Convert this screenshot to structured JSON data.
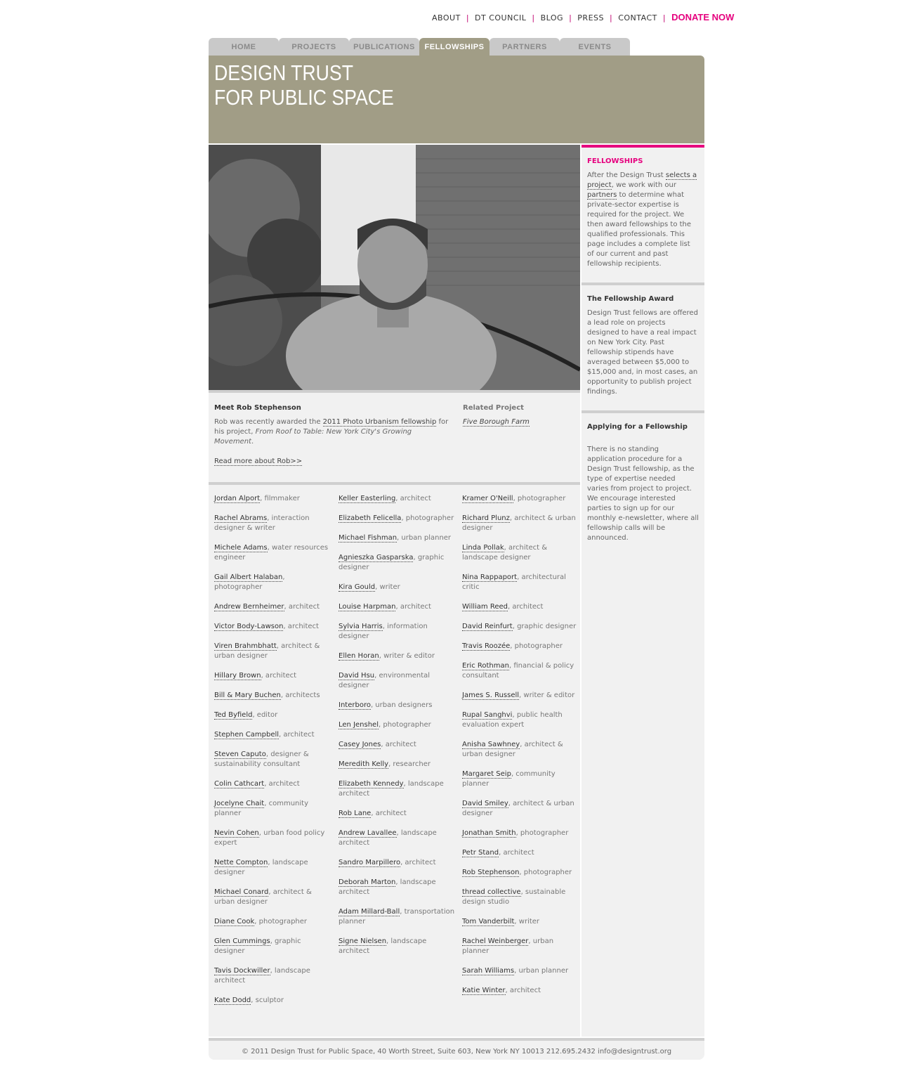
{
  "topnav": {
    "items": [
      "ABOUT",
      "DT COUNCIL",
      "BLOG",
      "PRESS",
      "CONTACT"
    ],
    "donate": "DONATE NOW"
  },
  "tabs": [
    "HOME",
    "PROJECTS",
    "PUBLICATIONS",
    "FELLOWSHIPS",
    "PARTNERS",
    "EVENTS"
  ],
  "active_tab": "FELLOWSHIPS",
  "logo": {
    "line1": "DESIGN TRUST",
    "line2": "FOR PUBLIC SPACE"
  },
  "colors": {
    "accent": "#e6007e",
    "banner": "#a19d86",
    "panel": "#f1f1f1"
  },
  "meet": {
    "title": "Meet Rob Stephenson",
    "text_before": "Rob was recently awarded the ",
    "link": "2011 Photo Urbanism fellowship",
    "text_mid": " for his project, ",
    "project_title": "From Roof to Table: New York City's Growing Movement",
    "text_end": ".",
    "read_more": "Read more about Rob>>"
  },
  "related": {
    "title": "Related Project",
    "link": "Five Borough Farm"
  },
  "fellows": {
    "col1": [
      {
        "name": "Jordan Alport",
        "role": ", filmmaker"
      },
      {
        "name": "Rachel Abrams",
        "role": ", interaction designer & writer"
      },
      {
        "name": "Michele Adams",
        "role": ", water resources engineer"
      },
      {
        "name": "Gail Albert Halaban",
        "role": ", photographer"
      },
      {
        "name": "Andrew Bernheimer",
        "role": ", architect"
      },
      {
        "name": "Victor Body-Lawson",
        "role": ", architect"
      },
      {
        "name": "Viren Brahmbhatt",
        "role": ", architect & urban designer"
      },
      {
        "name": "Hillary Brown",
        "role": ", architect"
      },
      {
        "name": "Bill & Mary Buchen",
        "role": ", architects"
      },
      {
        "name": "Ted Byfield",
        "role": ", editor"
      },
      {
        "name": "Stephen Campbell",
        "role": ", architect"
      },
      {
        "name": "Steven Caputo",
        "role": ", designer & sustainability consultant"
      },
      {
        "name": "Colin Cathcart",
        "role": ", architect"
      },
      {
        "name": "Jocelyne Chait",
        "role": ", community planner"
      },
      {
        "name": "Nevin Cohen",
        "role": ", urban food policy expert"
      },
      {
        "name": "Nette Compton",
        "role": ", landscape designer"
      },
      {
        "name": "Michael Conard",
        "role": ", architect & urban designer"
      },
      {
        "name": "Diane Cook",
        "role": ", photographer"
      },
      {
        "name": "Glen Cummings",
        "role": ", graphic designer"
      },
      {
        "name": "Tavis Dockwiller",
        "role": ", landscape architect"
      },
      {
        "name": "Kate Dodd",
        "role": ", sculptor"
      }
    ],
    "col2": [
      {
        "name": "Keller Easterling",
        "role": ", architect"
      },
      {
        "name": "Elizabeth Felicella",
        "role": ", photographer"
      },
      {
        "name": "Michael Fishman",
        "role": ", urban planner"
      },
      {
        "name": "Agnieszka Gasparska",
        "role": ", graphic designer"
      },
      {
        "name": "Kira Gould",
        "role": ", writer"
      },
      {
        "name": "Louise Harpman",
        "role": ", architect"
      },
      {
        "name": "Sylvia Harris",
        "role": ", information designer"
      },
      {
        "name": "Ellen Horan",
        "role": ", writer & editor"
      },
      {
        "name": "David Hsu",
        "role": ", environmental designer"
      },
      {
        "name": "Interboro",
        "role": ", urban designers"
      },
      {
        "name": "Len Jenshel",
        "role": ", photographer"
      },
      {
        "name": "Casey Jones",
        "role": ", architect"
      },
      {
        "name": "Meredith Kelly",
        "role": ", researcher"
      },
      {
        "name": "Elizabeth Kennedy",
        "role": ", landscape architect"
      },
      {
        "name": "Rob Lane",
        "role": ", architect"
      },
      {
        "name": "Andrew Lavallee",
        "role": ", landscape architect"
      },
      {
        "name": "Sandro Marpillero",
        "role": ", architect"
      },
      {
        "name": "Deborah Marton",
        "role": ", landscape architect"
      },
      {
        "name": "Adam Millard-Ball",
        "role": ", transportation planner"
      },
      {
        "name": "Signe Nielsen",
        "role": ", landscape architect"
      }
    ],
    "col3": [
      {
        "name": "Kramer O'Neill",
        "role": ", photographer"
      },
      {
        "name": "Richard Plunz",
        "role": ", architect & urban designer"
      },
      {
        "name": "Linda Pollak",
        "role": ", architect & landscape designer"
      },
      {
        "name": "Nina Rappaport",
        "role": ", architectural critic"
      },
      {
        "name": "William Reed",
        "role": ", architect"
      },
      {
        "name": "David Reinfurt",
        "role": ", graphic designer"
      },
      {
        "name": "Travis Roozée",
        "role": ", photographer"
      },
      {
        "name": "Eric Rothman",
        "role": ", financial & policy consultant"
      },
      {
        "name": "James S. Russell",
        "role": ", writer & editor"
      },
      {
        "name": "Rupal Sanghvi",
        "role": ", public health evaluation expert"
      },
      {
        "name": "Anisha Sawhney",
        "role": ", architect & urban designer"
      },
      {
        "name": "Margaret Seip",
        "role": ", community planner"
      },
      {
        "name": "David Smiley",
        "role": ", architect & urban designer"
      },
      {
        "name": "Jonathan Smith",
        "role": ", photographer"
      },
      {
        "name": "Petr Stand",
        "role": ", architect"
      },
      {
        "name": "Rob Stephenson",
        "role": ", photographer"
      },
      {
        "name": "thread collective",
        "role": ", sustainable design studio"
      },
      {
        "name": "Tom Vanderbilt",
        "role": ", writer"
      },
      {
        "name": "Rachel Weinberger",
        "role": ", urban planner"
      },
      {
        "name": "Sarah Williams",
        "role": ", urban planner"
      },
      {
        "name": "Katie Winter",
        "role": ", architect"
      }
    ]
  },
  "sidebar": {
    "fellowships": {
      "title": "FELLOWSHIPS",
      "t1": "After the Design Trust ",
      "link1": "selects a project",
      "t2": ", we work with our ",
      "link2": "partners",
      "t3": " to determine what private-sector expertise is required for the project. We then award fellowships to the qualified professionals. This page includes a complete list of our current and past fellowship recipients."
    },
    "award": {
      "title": "The Fellowship Award",
      "text": "Design Trust fellows are offered a lead role on projects designed to have a real impact on New York City. Past fellowship stipends have averaged between $5,000 to $15,000 and, in most cases, an opportunity to publish project findings."
    },
    "applying": {
      "title": "Applying for a Fellowship",
      "text": "There is no standing application procedure for a Design Trust fellowship, as the type of expertise needed varies from project to project. We encourage interested parties to sign up for our monthly e-newsletter, where all fellowship calls will be announced."
    }
  },
  "footer": "© 2011 Design Trust for Public Space, 40 Worth Street, Suite 603, New York NY 10013  212.695.2432   info@designtrust.org"
}
